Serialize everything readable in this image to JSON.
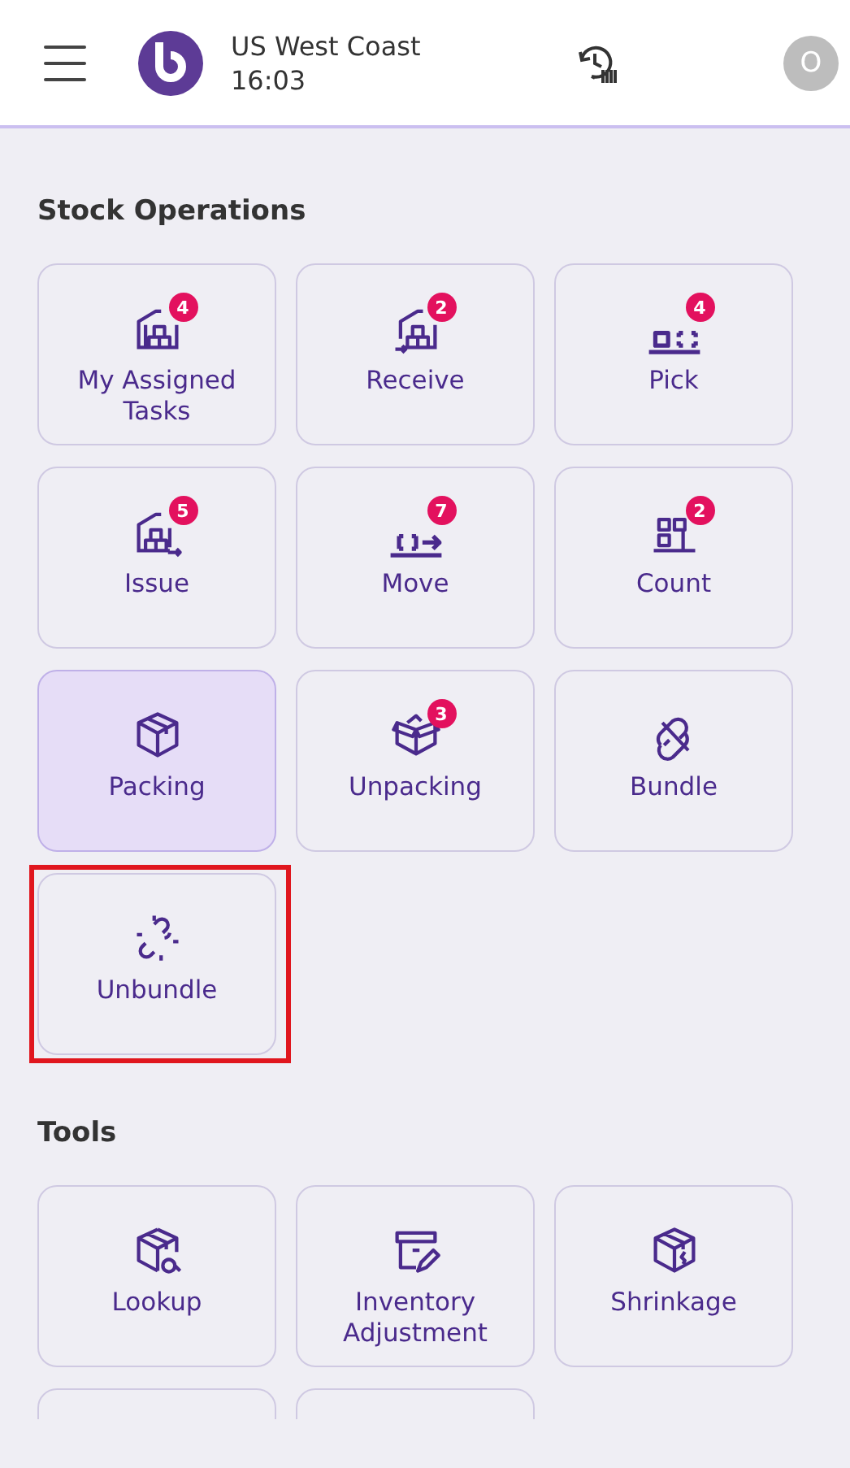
{
  "header": {
    "location": "US West Coast",
    "time": "16:03",
    "avatar": "O"
  },
  "sections": [
    {
      "title": "Stock Operations",
      "tiles": [
        {
          "label": "My Assigned Tasks",
          "badge": "4",
          "selected": false,
          "highlighted": false
        },
        {
          "label": "Receive",
          "badge": "2",
          "selected": false,
          "highlighted": false
        },
        {
          "label": "Pick",
          "badge": "4",
          "selected": false,
          "highlighted": false
        },
        {
          "label": "Issue",
          "badge": "5",
          "selected": false,
          "highlighted": false
        },
        {
          "label": "Move",
          "badge": "7",
          "selected": false,
          "highlighted": false
        },
        {
          "label": "Count",
          "badge": "2",
          "selected": false,
          "highlighted": false
        },
        {
          "label": "Packing",
          "selected": true,
          "highlighted": false
        },
        {
          "label": "Unpacking",
          "badge": "3",
          "selected": false,
          "highlighted": false
        },
        {
          "label": "Bundle",
          "selected": false,
          "highlighted": false
        },
        {
          "label": "Unbundle",
          "selected": false,
          "highlighted": true
        }
      ]
    },
    {
      "title": "Tools",
      "tiles": [
        {
          "label": "Lookup",
          "selected": false,
          "highlighted": false
        },
        {
          "label": "Inventory Adjustment",
          "selected": false,
          "highlighted": false
        },
        {
          "label": "Shrinkage",
          "selected": false,
          "highlighted": false
        },
        {
          "kind": "clipped"
        },
        {
          "kind": "clipped"
        }
      ]
    }
  ]
}
